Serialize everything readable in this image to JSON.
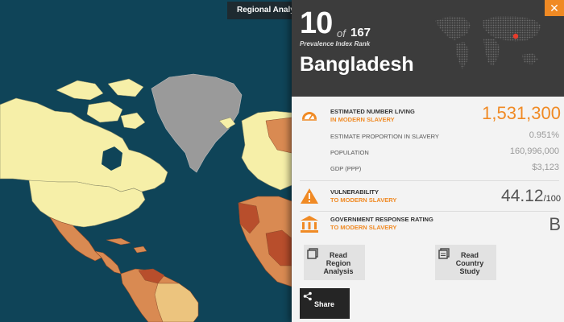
{
  "map": {
    "tab_label": "Regional Analysis"
  },
  "panel": {
    "rank": "10",
    "rank_of": "of",
    "rank_total": "167",
    "rank_caption": "Prevalence Index Rank",
    "country": "Bangladesh",
    "close_glyph": "✕",
    "enslaved": {
      "label_line1": "ESTIMATED NUMBER LIVING",
      "label_line2": "IN MODERN SLAVERY",
      "value": "1,531,300"
    },
    "proportion": {
      "label": "ESTIMATE PROPORTION IN SLAVERY",
      "value": "0.951%"
    },
    "population": {
      "label": "POPULATION",
      "value": "160,996,000"
    },
    "gdp": {
      "label": "GDP (PPP)",
      "value": "$3,123"
    },
    "vulnerability": {
      "label_line1": "VULNERABILITY",
      "label_line2": "TO MODERN SLAVERY",
      "value": "44.12",
      "suffix": "/100"
    },
    "government": {
      "label_line1": "GOVERNMENT RESPONSE RATING",
      "label_line2": "TO MODERN SLAVERY",
      "value": "B"
    },
    "buttons": {
      "region_analysis": "Read Region Analysis",
      "country_study": "Read Country Study",
      "share": "Share"
    }
  },
  "colors": {
    "accent": "#f08a24",
    "ocean": "#0f4458",
    "panel_header": "#3c3c3c",
    "land_light": "#f6efa8",
    "land_mid": "#d98a52",
    "land_dark": "#b84e2c",
    "land_nodata": "#9a9a9a"
  },
  "icons": {
    "enslaved": "gauge-icon",
    "vulnerability": "warning-triangle-icon",
    "government": "government-building-icon",
    "region": "document-icon",
    "country": "document-icon",
    "share": "share-icon",
    "close": "close-icon"
  }
}
